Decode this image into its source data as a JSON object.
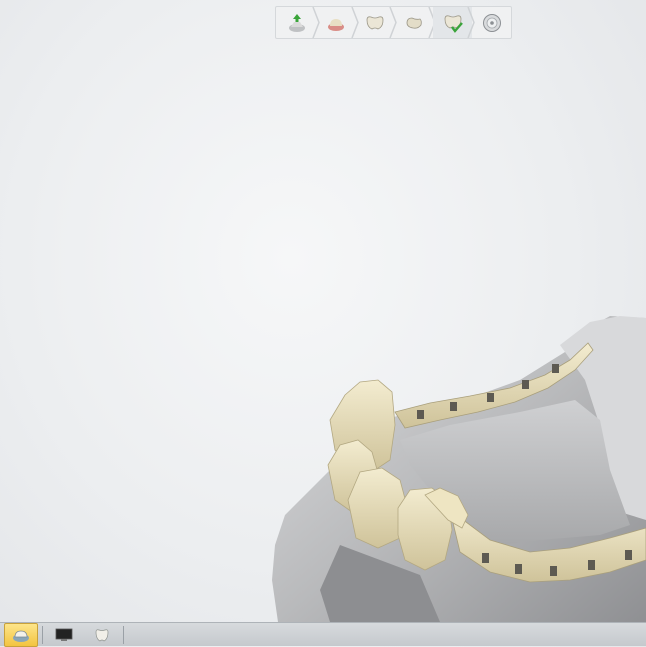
{
  "workflow_steps": [
    {
      "icon": "model-import-icon",
      "active": false
    },
    {
      "icon": "gingiva-model-icon",
      "active": false
    },
    {
      "icon": "crown-tooth-icon",
      "active": false
    },
    {
      "icon": "tooth-adapt-icon",
      "active": false
    },
    {
      "icon": "tooth-check-icon",
      "active": true
    },
    {
      "icon": "export-disc-icon",
      "active": false
    }
  ],
  "bottom_toolbar": [
    {
      "icon": "dental-model-view-icon",
      "active": true
    },
    {
      "icon": "screenshot-monitor-icon",
      "active": false
    },
    {
      "icon": "crown-view-icon",
      "active": false
    }
  ],
  "colors": {
    "tooth": "#e9dfb9",
    "model": "#c3c4c6",
    "accent_green": "#3aa43a"
  }
}
